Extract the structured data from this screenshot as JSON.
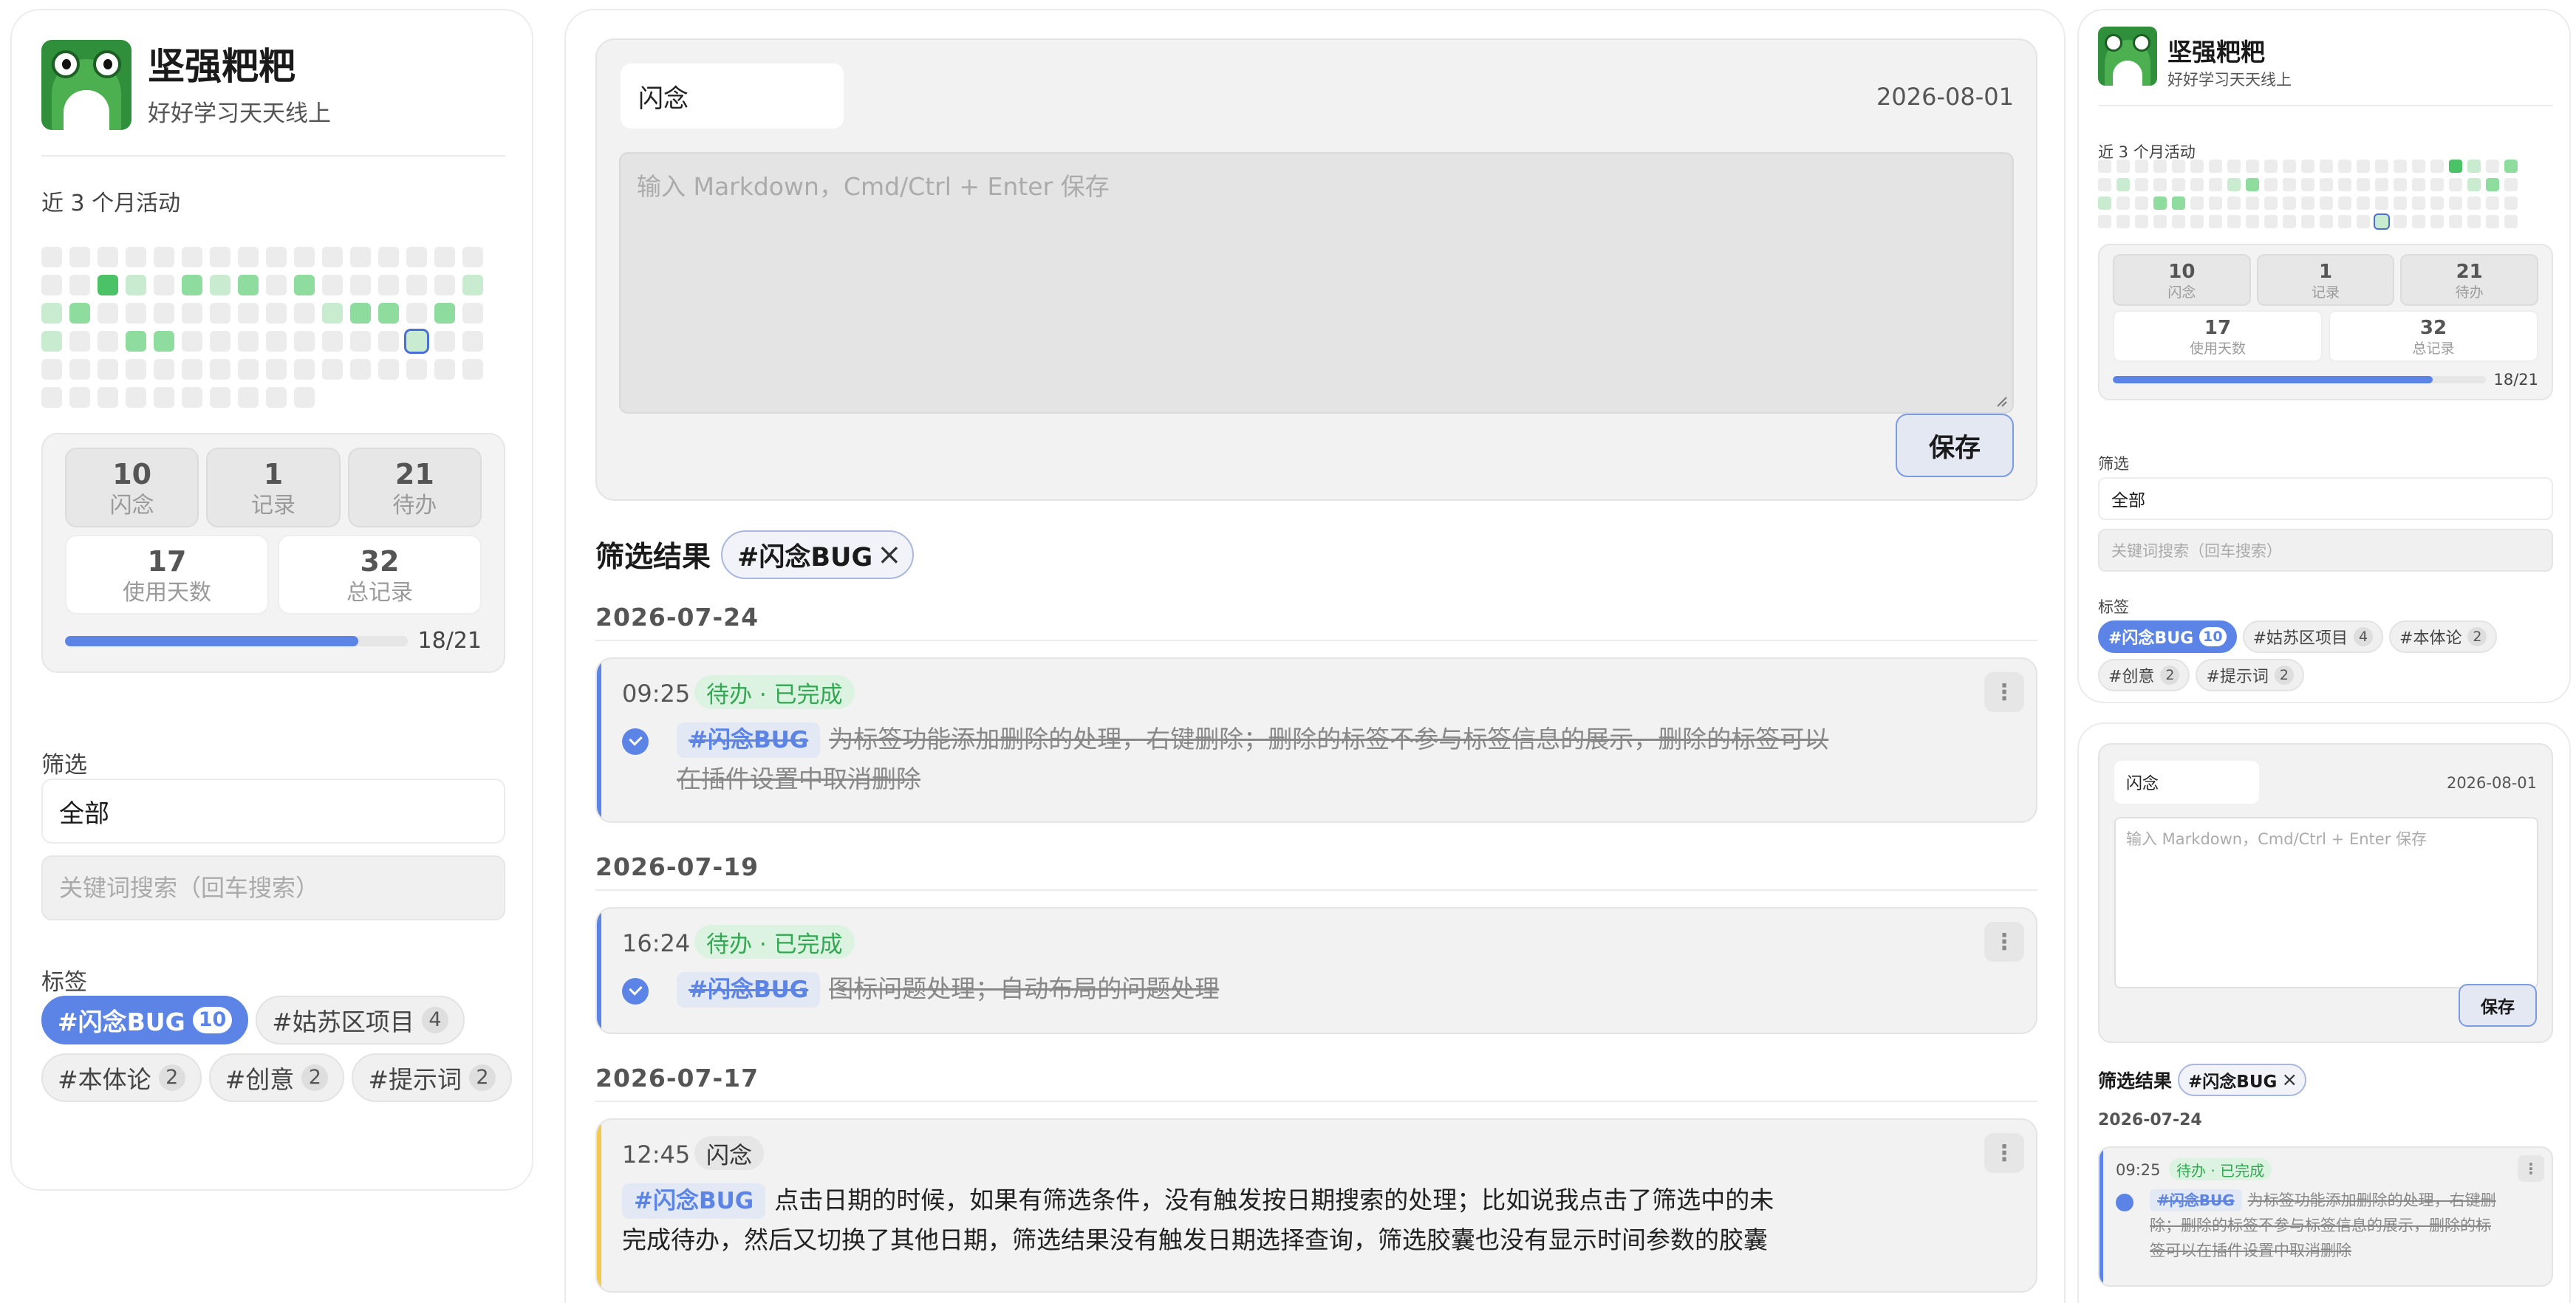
{
  "profile": {
    "name": "坚强粑粑",
    "motto": "好好学习天天线上"
  },
  "activity": {
    "label": "近 3 个月活动"
  },
  "stats": {
    "memo": {
      "value": "10",
      "label": "闪念"
    },
    "record": {
      "value": "1",
      "label": "记录"
    },
    "todo": {
      "value": "21",
      "label": "待办"
    },
    "days": {
      "value": "17",
      "label": "使用天数"
    },
    "total": {
      "value": "32",
      "label": "总记录"
    },
    "progress_text": "18/21",
    "progress_fraction": 0.857
  },
  "filter": {
    "label": "筛选",
    "selected": "全部",
    "search_placeholder": "关键词搜索（回车搜索）"
  },
  "tags": {
    "label": "标签",
    "items": [
      {
        "name": "#闪念BUG",
        "count": "10",
        "active": true
      },
      {
        "name": "#姑苏区项目",
        "count": "4",
        "active": false
      },
      {
        "name": "#本体论",
        "count": "2",
        "active": false
      },
      {
        "name": "#创意",
        "count": "2",
        "active": false
      },
      {
        "name": "#提示词",
        "count": "2",
        "active": false
      }
    ]
  },
  "editor": {
    "type": "闪念",
    "date": "2026-08-01",
    "placeholder": "输入 Markdown，Cmd/Ctrl + Enter 保存",
    "save_label": "保存"
  },
  "results": {
    "title": "筛选结果",
    "chip": "#闪念BUG",
    "chip_close": "×",
    "groups": [
      {
        "date": "2026-07-24",
        "entries": [
          {
            "time": "09:25",
            "badge": "待办 · 已完成",
            "tag": "#闪念BUG",
            "line1": "为标签功能添加删除的处理，右键删除；删除的标签不参与标签信息的展示，删除的标签可以",
            "line2": "在插件设置中取消删除"
          }
        ]
      },
      {
        "date": "2026-07-19",
        "entries": [
          {
            "time": "16:24",
            "badge": "待办 · 已完成",
            "tag": "#闪念BUG",
            "line1": "图标问题处理；自动布局的问题处理"
          }
        ]
      },
      {
        "date": "2026-07-17",
        "entries": [
          {
            "time": "12:45",
            "badge": "闪念",
            "tag": "#闪念BUG",
            "line1": "点击日期的时候，如果有筛选条件，没有触发按日期搜索的处理；比如说我点击了筛选中的未",
            "line2": "完成待办，然后又切换了其他日期，筛选结果没有触发日期选择查询，筛选胶囊也没有显示时间参数的胶囊"
          }
        ]
      }
    ]
  },
  "mini_card": {
    "line1": "为标签功能添加删除的处理，右键删",
    "line2": "除；删除的标签不参与标签信息的展示，删除的标",
    "line3": "签可以在插件设置中取消删除"
  },
  "icons": {
    "menu": "vertical-dots-icon",
    "check": "check-circle-icon",
    "close": "close-icon",
    "avatar": "frog-avatar"
  },
  "colors": {
    "accent": "#5b84e6",
    "done_green": "#32a852",
    "memo_yellow": "#f2c94c",
    "heat_levels": [
      "#ececec",
      "#c9ecd0",
      "#8fdc9f",
      "#4cc266"
    ]
  }
}
